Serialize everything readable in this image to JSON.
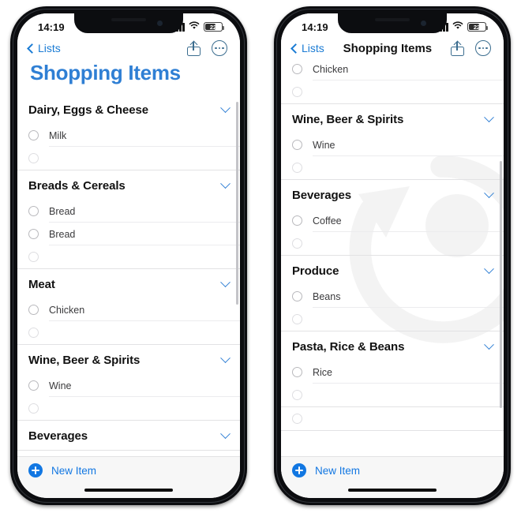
{
  "phones": [
    {
      "id": "phone-left",
      "status_bar": {
        "time": "14:19",
        "battery_percent": "22",
        "cellular": "signal-bars-icon",
        "wifi": "wifi-icon"
      },
      "nav": {
        "back_label": "Lists",
        "title": "",
        "share_icon": "share-icon",
        "more_icon": "more-circle-icon",
        "show_inline_title": false
      },
      "large_title": "Shopping Items",
      "show_large_title": true,
      "show_watermark": false,
      "scroll": {
        "top_pct": 2,
        "height_pct": 56
      },
      "sections": [
        {
          "title": "Dairy, Eggs & Cheese",
          "collapse_icon": "chevron-down-icon",
          "rows": [
            {
              "label": "Milk",
              "placeholder": false
            },
            {
              "label": "",
              "placeholder": true
            }
          ]
        },
        {
          "title": "Breads & Cereals",
          "collapse_icon": "chevron-down-icon",
          "rows": [
            {
              "label": "Bread",
              "placeholder": false
            },
            {
              "label": "Bread",
              "placeholder": false
            },
            {
              "label": "",
              "placeholder": true
            }
          ]
        },
        {
          "title": "Meat",
          "collapse_icon": "chevron-down-icon",
          "rows": [
            {
              "label": "Chicken",
              "placeholder": false
            },
            {
              "label": "",
              "placeholder": true
            }
          ]
        },
        {
          "title": "Wine, Beer & Spirits",
          "collapse_icon": "chevron-down-icon",
          "rows": [
            {
              "label": "Wine",
              "placeholder": false
            },
            {
              "label": "",
              "placeholder": true
            }
          ]
        },
        {
          "title": "Beverages",
          "collapse_icon": "chevron-down-icon",
          "rows": []
        }
      ],
      "new_item": {
        "label": "New Item",
        "icon": "plus-circle-icon"
      }
    },
    {
      "id": "phone-right",
      "status_bar": {
        "time": "14:19",
        "battery_percent": "22",
        "cellular": "signal-bars-icon",
        "wifi": "wifi-icon"
      },
      "nav": {
        "back_label": "Lists",
        "title": "Shopping Items",
        "share_icon": "share-icon",
        "more_icon": "more-circle-icon",
        "show_inline_title": true
      },
      "large_title": "",
      "show_large_title": false,
      "show_watermark": true,
      "scroll": {
        "top_pct": 26,
        "height_pct": 62
      },
      "lead_rows": [
        {
          "label": "Chicken",
          "placeholder": false
        },
        {
          "label": "",
          "placeholder": true
        }
      ],
      "sections": [
        {
          "title": "Wine, Beer & Spirits",
          "collapse_icon": "chevron-down-icon",
          "rows": [
            {
              "label": "Wine",
              "placeholder": false
            },
            {
              "label": "",
              "placeholder": true
            }
          ]
        },
        {
          "title": "Beverages",
          "collapse_icon": "chevron-down-icon",
          "rows": [
            {
              "label": "Coffee",
              "placeholder": false
            },
            {
              "label": "",
              "placeholder": true
            }
          ]
        },
        {
          "title": "Produce",
          "collapse_icon": "chevron-down-icon",
          "rows": [
            {
              "label": "Beans",
              "placeholder": false
            },
            {
              "label": "",
              "placeholder": true
            }
          ]
        },
        {
          "title": "Pasta, Rice & Beans",
          "collapse_icon": "chevron-down-icon",
          "rows": [
            {
              "label": "Rice",
              "placeholder": false
            },
            {
              "label": "",
              "placeholder": true
            }
          ]
        }
      ],
      "trail_rows": [
        {
          "label": "",
          "placeholder": true
        }
      ],
      "new_item": {
        "label": "New Item",
        "icon": "plus-circle-icon"
      }
    }
  ]
}
